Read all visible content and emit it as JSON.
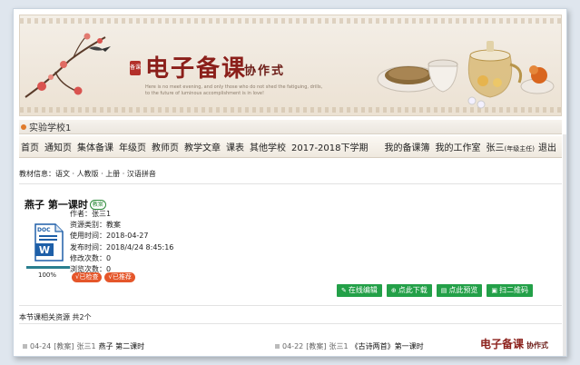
{
  "banner": {
    "seal": "备课",
    "title": "电子备课",
    "subtitle": "协作式",
    "english_text": "Here is no meet evening, and only those who do not shed the fatiguing, drills, to the future of luminous accomplishment is in love!"
  },
  "school": {
    "name": "实验学校1"
  },
  "nav": {
    "items": [
      "首页",
      "通知页",
      "集体备课",
      "年级页",
      "教师页",
      "教学文章",
      "课表",
      "其他学校",
      "2017-2018下学期"
    ],
    "right_items": [
      "我的备课簿",
      "我的工作室"
    ],
    "user": "张三",
    "user_role": "(年级主任)",
    "logout": "退出"
  },
  "material": {
    "text": "教材信息：语文 · 人教版 · 上册 · 汉语拼音"
  },
  "doc": {
    "title": "燕子 第一课时",
    "tag": "教案",
    "icon_label": "DOC",
    "icon_letter": "W",
    "progress_percent": 100,
    "progress_label": "100%",
    "meta": [
      "作者：张三1",
      "资源类别：教案",
      "使用时间：2018-04-27",
      "发布时间：2018/4/24 8:45:16",
      "修改次数：0",
      "浏览次数：0"
    ],
    "badges": [
      "√已检查",
      "√已推荐"
    ]
  },
  "actions": [
    {
      "label": "在线编辑",
      "icon": "pencil-icon",
      "glyph": "✎"
    },
    {
      "label": "点此下载",
      "icon": "download-icon",
      "glyph": "⊕"
    },
    {
      "label": "点此预览",
      "icon": "book-icon",
      "glyph": "▤"
    },
    {
      "label": "扫二维码",
      "icon": "qrcode-icon",
      "glyph": "▣"
    }
  ],
  "related": {
    "header": "本节课相关资源 共2个",
    "items": [
      {
        "date": "04-24",
        "type": "[教案]",
        "author": "张三1",
        "title": "燕子 第二课时"
      },
      {
        "date": "04-22",
        "type": "[教案]",
        "author": "张三1",
        "title": "《古诗两首》第一课时"
      }
    ]
  },
  "watermark": {
    "title": "电子备课",
    "subtitle": "协作式"
  },
  "colors": {
    "accent_green": "#23a048",
    "badge_red": "#e5562a",
    "title_red": "#8b1f1a"
  }
}
